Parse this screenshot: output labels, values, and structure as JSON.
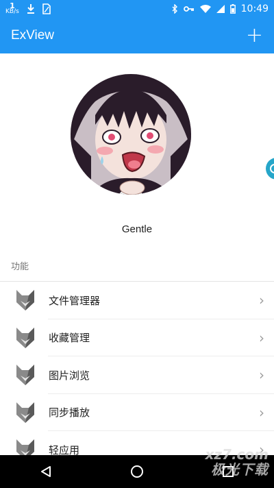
{
  "status_bar": {
    "speed_value": "1",
    "speed_unit": "KB/s",
    "time": "10:49",
    "icons": [
      "download-icon",
      "sim-card-icon",
      "bluetooth-icon",
      "key-icon",
      "wifi-icon",
      "cell-signal-icon",
      "battery-icon"
    ]
  },
  "app_bar": {
    "title": "ExView",
    "add_label": "+"
  },
  "profile": {
    "username": "Gentle"
  },
  "section": {
    "title": "功能"
  },
  "menu": {
    "items": [
      {
        "label": "文件管理器",
        "icon": "fox-icon"
      },
      {
        "label": "收藏管理",
        "icon": "fox-icon"
      },
      {
        "label": "图片浏览",
        "icon": "fox-icon"
      },
      {
        "label": "同步播放",
        "icon": "fox-icon"
      },
      {
        "label": "轻应用",
        "icon": "fox-icon"
      }
    ]
  },
  "watermark": {
    "line1": "xz7.com",
    "line2": "极光下载"
  },
  "colors": {
    "primary": "#2196f3",
    "accent_fab": "#26a6c9",
    "nav_bg": "#000000"
  }
}
